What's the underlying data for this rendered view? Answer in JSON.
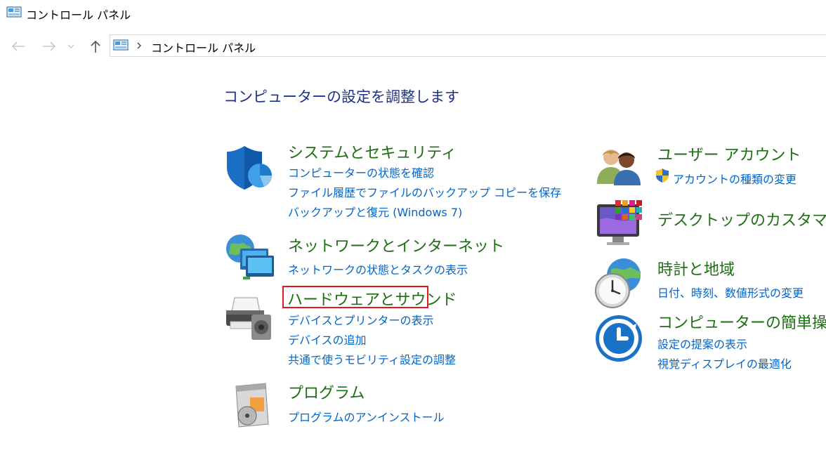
{
  "window": {
    "title": "コントロール パネル"
  },
  "address": {
    "crumb": "コントロール パネル"
  },
  "page": {
    "heading": "コンピューターの設定を調整します"
  },
  "categories_left": [
    {
      "heading": "システムとセキュリティ",
      "icon": "shield-icon",
      "links": [
        "コンピューターの状態を確認",
        "ファイル履歴でファイルのバックアップ コピーを保存",
        "バックアップと復元 (Windows 7)"
      ]
    },
    {
      "heading": "ネットワークとインターネット",
      "icon": "network-globe-icon",
      "links": [
        "ネットワークの状態とタスクの表示"
      ]
    },
    {
      "heading": "ハードウェアとサウンド",
      "icon": "printer-speaker-icon",
      "links": [
        "デバイスとプリンターの表示",
        "デバイスの追加",
        "共通で使うモビリティ設定の調整"
      ]
    },
    {
      "heading": "プログラム",
      "icon": "programs-disc-icon",
      "links": [
        "プログラムのアンインストール"
      ]
    }
  ],
  "categories_right": [
    {
      "heading": "ユーザー アカウント",
      "icon": "users-icon",
      "links": [
        "アカウントの種類の変更"
      ]
    },
    {
      "heading": "デスクトップのカスタマイズ",
      "icon": "desktop-monitor-icon",
      "links": []
    },
    {
      "heading": "時計と地域",
      "icon": "clock-globe-icon",
      "links": [
        "日付、時刻、数値形式の変更"
      ]
    },
    {
      "heading": "コンピューターの簡単操作",
      "icon": "ease-of-access-icon",
      "links": [
        "設定の提案の表示",
        "視覚ディスプレイの最適化"
      ]
    }
  ],
  "colors": {
    "heading_green": "#1e6e14",
    "link_blue": "#0066cc",
    "title_blue": "#1e3287",
    "highlight_red": "#e81818"
  }
}
